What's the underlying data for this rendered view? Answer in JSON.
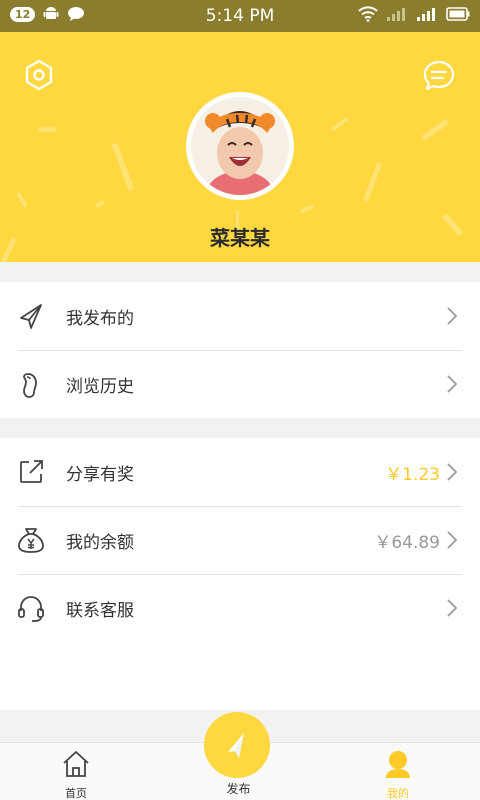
{
  "status_bar": {
    "notification_count": "12",
    "time": "5:14 PM"
  },
  "profile": {
    "username": "菜某某"
  },
  "menu_group_1": [
    {
      "label": "我发布的",
      "icon": "send-icon"
    },
    {
      "label": "浏览历史",
      "icon": "footprint-icon"
    }
  ],
  "menu_group_2": [
    {
      "label": "分享有奖",
      "value": "￥1.23",
      "icon": "share-icon"
    },
    {
      "label": "我的余额",
      "value": "￥64.89",
      "icon": "money-bag-icon"
    },
    {
      "label": "联系客服",
      "icon": "headset-icon"
    }
  ],
  "tabbar": {
    "home": "首页",
    "publish": "发布",
    "mine": "我的"
  },
  "colors": {
    "accent": "#ffd73f",
    "accent_text": "#ffc928"
  }
}
